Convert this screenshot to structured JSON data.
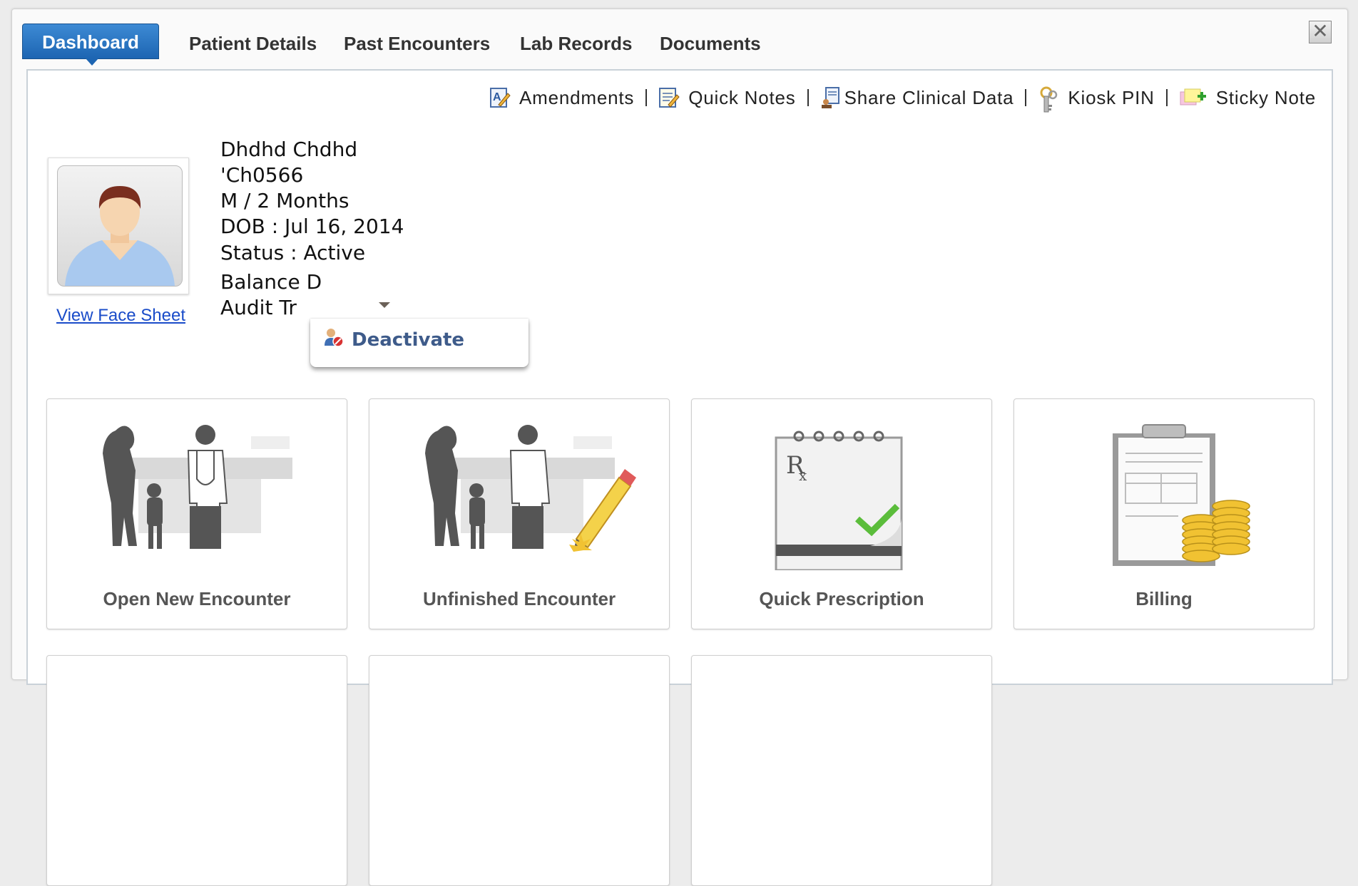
{
  "tabs": [
    {
      "label": "Dashboard",
      "active": true
    },
    {
      "label": "Patient Details"
    },
    {
      "label": "Past Encounters"
    },
    {
      "label": "Lab Records"
    },
    {
      "label": "Documents"
    }
  ],
  "toolbar": {
    "amendments": "Amendments",
    "quick_notes": "Quick Notes",
    "share_clinical_data": "Share Clinical Data",
    "kiosk_pin": "Kiosk PIN",
    "sticky_note": "Sticky Note"
  },
  "patient": {
    "name": "Dhdhd Chdhd",
    "id": "'Ch0566",
    "sex_age": "M / 2 Months",
    "dob": "DOB : Jul 16, 2014",
    "status": "Status : Active",
    "balance": "Balance D",
    "audit": "Audit Tr",
    "view_face_sheet": "View Face Sheet"
  },
  "status_menu": {
    "deactivate": "Deactivate"
  },
  "cards": [
    {
      "label": "Open New Encounter"
    },
    {
      "label": "Unfinished Encounter"
    },
    {
      "label": "Quick Prescription"
    },
    {
      "label": "Billing"
    }
  ],
  "colors": {
    "accent": "#1d65b2",
    "link": "#1a4cc9",
    "menu_text": "#3e5b8a"
  }
}
